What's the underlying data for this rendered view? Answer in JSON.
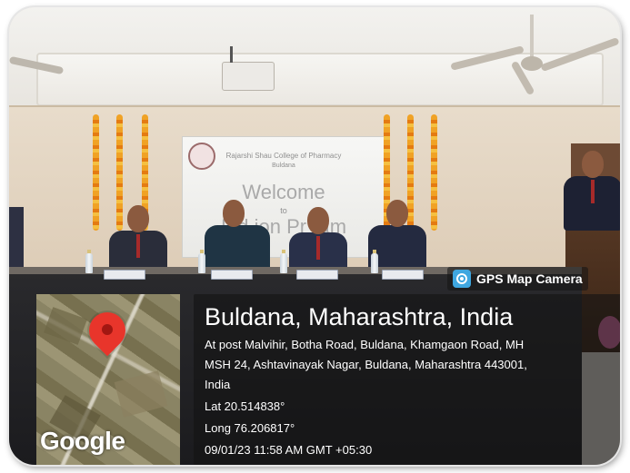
{
  "photo": {
    "screen": {
      "college": "Rajarshi Shau College of Pharmacy",
      "city": "Buldana",
      "welcome": "Welcome",
      "to": "to",
      "program": "Ind   ion Pr  ram"
    }
  },
  "overlay": {
    "app_name": "GPS Map Camera",
    "app_icon": "camera-lens-icon",
    "map_logo": "Google",
    "location_title": "Buldana, Maharashtra, India",
    "address_line1": "At post Malvihir, Botha Road, Buldana, Khamgaon Road, MH",
    "address_line2": "MSH 24, Ashtavinayak Nagar, Buldana, Maharashtra 443001,",
    "address_line3": "India",
    "latitude": "Lat 20.514838°",
    "longitude": "Long 76.206817°",
    "timestamp": "09/01/23 11:58 AM GMT +05:30",
    "pin_color": "#e8352b",
    "panel_color": "#141414"
  }
}
